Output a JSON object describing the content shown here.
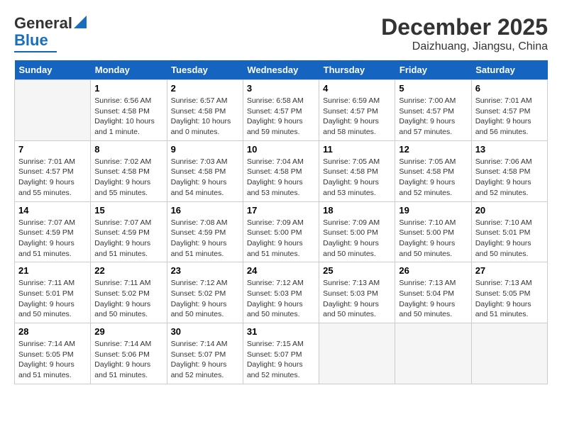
{
  "header": {
    "logo_general": "General",
    "logo_blue": "Blue",
    "title": "December 2025",
    "subtitle": "Daizhuang, Jiangsu, China"
  },
  "days_of_week": [
    "Sunday",
    "Monday",
    "Tuesday",
    "Wednesday",
    "Thursday",
    "Friday",
    "Saturday"
  ],
  "weeks": [
    [
      {
        "day": "",
        "sunrise": "",
        "sunset": "",
        "daylight": ""
      },
      {
        "day": "1",
        "sunrise": "Sunrise: 6:56 AM",
        "sunset": "Sunset: 4:58 PM",
        "daylight": "Daylight: 10 hours and 1 minute."
      },
      {
        "day": "2",
        "sunrise": "Sunrise: 6:57 AM",
        "sunset": "Sunset: 4:58 PM",
        "daylight": "Daylight: 10 hours and 0 minutes."
      },
      {
        "day": "3",
        "sunrise": "Sunrise: 6:58 AM",
        "sunset": "Sunset: 4:57 PM",
        "daylight": "Daylight: 9 hours and 59 minutes."
      },
      {
        "day": "4",
        "sunrise": "Sunrise: 6:59 AM",
        "sunset": "Sunset: 4:57 PM",
        "daylight": "Daylight: 9 hours and 58 minutes."
      },
      {
        "day": "5",
        "sunrise": "Sunrise: 7:00 AM",
        "sunset": "Sunset: 4:57 PM",
        "daylight": "Daylight: 9 hours and 57 minutes."
      },
      {
        "day": "6",
        "sunrise": "Sunrise: 7:01 AM",
        "sunset": "Sunset: 4:57 PM",
        "daylight": "Daylight: 9 hours and 56 minutes."
      }
    ],
    [
      {
        "day": "7",
        "sunrise": "Sunrise: 7:01 AM",
        "sunset": "Sunset: 4:57 PM",
        "daylight": "Daylight: 9 hours and 55 minutes."
      },
      {
        "day": "8",
        "sunrise": "Sunrise: 7:02 AM",
        "sunset": "Sunset: 4:58 PM",
        "daylight": "Daylight: 9 hours and 55 minutes."
      },
      {
        "day": "9",
        "sunrise": "Sunrise: 7:03 AM",
        "sunset": "Sunset: 4:58 PM",
        "daylight": "Daylight: 9 hours and 54 minutes."
      },
      {
        "day": "10",
        "sunrise": "Sunrise: 7:04 AM",
        "sunset": "Sunset: 4:58 PM",
        "daylight": "Daylight: 9 hours and 53 minutes."
      },
      {
        "day": "11",
        "sunrise": "Sunrise: 7:05 AM",
        "sunset": "Sunset: 4:58 PM",
        "daylight": "Daylight: 9 hours and 53 minutes."
      },
      {
        "day": "12",
        "sunrise": "Sunrise: 7:05 AM",
        "sunset": "Sunset: 4:58 PM",
        "daylight": "Daylight: 9 hours and 52 minutes."
      },
      {
        "day": "13",
        "sunrise": "Sunrise: 7:06 AM",
        "sunset": "Sunset: 4:58 PM",
        "daylight": "Daylight: 9 hours and 52 minutes."
      }
    ],
    [
      {
        "day": "14",
        "sunrise": "Sunrise: 7:07 AM",
        "sunset": "Sunset: 4:59 PM",
        "daylight": "Daylight: 9 hours and 51 minutes."
      },
      {
        "day": "15",
        "sunrise": "Sunrise: 7:07 AM",
        "sunset": "Sunset: 4:59 PM",
        "daylight": "Daylight: 9 hours and 51 minutes."
      },
      {
        "day": "16",
        "sunrise": "Sunrise: 7:08 AM",
        "sunset": "Sunset: 4:59 PM",
        "daylight": "Daylight: 9 hours and 51 minutes."
      },
      {
        "day": "17",
        "sunrise": "Sunrise: 7:09 AM",
        "sunset": "Sunset: 5:00 PM",
        "daylight": "Daylight: 9 hours and 51 minutes."
      },
      {
        "day": "18",
        "sunrise": "Sunrise: 7:09 AM",
        "sunset": "Sunset: 5:00 PM",
        "daylight": "Daylight: 9 hours and 50 minutes."
      },
      {
        "day": "19",
        "sunrise": "Sunrise: 7:10 AM",
        "sunset": "Sunset: 5:00 PM",
        "daylight": "Daylight: 9 hours and 50 minutes."
      },
      {
        "day": "20",
        "sunrise": "Sunrise: 7:10 AM",
        "sunset": "Sunset: 5:01 PM",
        "daylight": "Daylight: 9 hours and 50 minutes."
      }
    ],
    [
      {
        "day": "21",
        "sunrise": "Sunrise: 7:11 AM",
        "sunset": "Sunset: 5:01 PM",
        "daylight": "Daylight: 9 hours and 50 minutes."
      },
      {
        "day": "22",
        "sunrise": "Sunrise: 7:11 AM",
        "sunset": "Sunset: 5:02 PM",
        "daylight": "Daylight: 9 hours and 50 minutes."
      },
      {
        "day": "23",
        "sunrise": "Sunrise: 7:12 AM",
        "sunset": "Sunset: 5:02 PM",
        "daylight": "Daylight: 9 hours and 50 minutes."
      },
      {
        "day": "24",
        "sunrise": "Sunrise: 7:12 AM",
        "sunset": "Sunset: 5:03 PM",
        "daylight": "Daylight: 9 hours and 50 minutes."
      },
      {
        "day": "25",
        "sunrise": "Sunrise: 7:13 AM",
        "sunset": "Sunset: 5:03 PM",
        "daylight": "Daylight: 9 hours and 50 minutes."
      },
      {
        "day": "26",
        "sunrise": "Sunrise: 7:13 AM",
        "sunset": "Sunset: 5:04 PM",
        "daylight": "Daylight: 9 hours and 50 minutes."
      },
      {
        "day": "27",
        "sunrise": "Sunrise: 7:13 AM",
        "sunset": "Sunset: 5:05 PM",
        "daylight": "Daylight: 9 hours and 51 minutes."
      }
    ],
    [
      {
        "day": "28",
        "sunrise": "Sunrise: 7:14 AM",
        "sunset": "Sunset: 5:05 PM",
        "daylight": "Daylight: 9 hours and 51 minutes."
      },
      {
        "day": "29",
        "sunrise": "Sunrise: 7:14 AM",
        "sunset": "Sunset: 5:06 PM",
        "daylight": "Daylight: 9 hours and 51 minutes."
      },
      {
        "day": "30",
        "sunrise": "Sunrise: 7:14 AM",
        "sunset": "Sunset: 5:07 PM",
        "daylight": "Daylight: 9 hours and 52 minutes."
      },
      {
        "day": "31",
        "sunrise": "Sunrise: 7:15 AM",
        "sunset": "Sunset: 5:07 PM",
        "daylight": "Daylight: 9 hours and 52 minutes."
      },
      {
        "day": "",
        "sunrise": "",
        "sunset": "",
        "daylight": ""
      },
      {
        "day": "",
        "sunrise": "",
        "sunset": "",
        "daylight": ""
      },
      {
        "day": "",
        "sunrise": "",
        "sunset": "",
        "daylight": ""
      }
    ]
  ]
}
